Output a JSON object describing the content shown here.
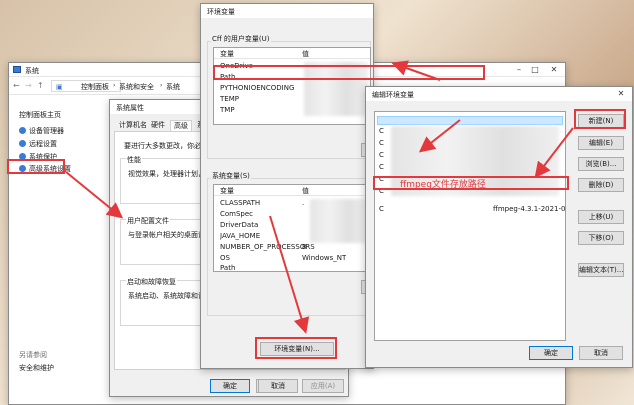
{
  "system_window": {
    "title": "系统",
    "breadcrumb": [
      "控制面板",
      "系统和安全",
      "系统"
    ],
    "sidebar_home": "控制面板主页",
    "sidebar_items": [
      "设备管理器",
      "远程设置",
      "系统保护",
      "高级系统设置"
    ],
    "see_also": "另请参阅",
    "security_maintenance": "安全和维护"
  },
  "sys_props": {
    "title": "系统属性",
    "tabs": [
      "计算机名",
      "硬件",
      "高级",
      "系"
    ],
    "admin_note": "要进行大多数更改，你必须",
    "performance_label": "性能",
    "performance_desc": "视觉效果，处理器计划，内",
    "profile_label": "用户配置文件",
    "profile_desc": "与登录帐户相关的桌面设置",
    "startup_label": "启动和故障恢复",
    "startup_desc": "系统启动、系统故障和调试",
    "ok": "确定",
    "cancel": "取消",
    "apply": "应用(A)"
  },
  "env_vars": {
    "title": "环境变量",
    "user_group": "Cff 的用户变量(U)",
    "col_var": "变量",
    "col_val": "值",
    "user_vars": [
      "OneDrive",
      "Path",
      "PYTHONIOENCODING",
      "TEMP",
      "TMP"
    ],
    "system_group": "系统变量(S)",
    "system_vars": [
      {
        "name": "CLASSPATH",
        "value": "."
      },
      {
        "name": "ComSpec",
        "value": ""
      },
      {
        "name": "DriverData",
        "value": ""
      },
      {
        "name": "JAVA_HOME",
        "value": ""
      },
      {
        "name": "NUMBER_OF_PROCESSORS",
        "value": "8"
      },
      {
        "name": "OS",
        "value": "Windows_NT"
      },
      {
        "name": "Path",
        "value": ""
      }
    ],
    "env_button": "环境变量(N)...",
    "ok": "确定",
    "cancel": "取消"
  },
  "edit_env": {
    "title": "编辑环境变量",
    "row_prefix": "C",
    "annotation": "ffmpeg文件存放路径",
    "path_value": "ffmpeg-4.3.1-2021-01-0...",
    "buttons": [
      "新建(N)",
      "编辑(E)",
      "浏览(B)...",
      "删除(D)",
      "上移(U)",
      "下移(O)",
      "编辑文本(T)..."
    ],
    "ok": "确定",
    "cancel": "取消"
  },
  "colors": {
    "annotation_red": "#e4393c",
    "selection_blue": "#cce8ff",
    "accent_blue": "#0078d7"
  }
}
